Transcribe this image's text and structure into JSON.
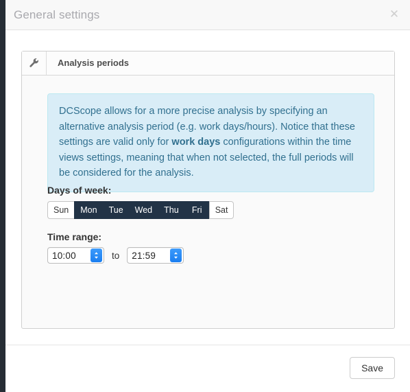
{
  "modal": {
    "title": "General settings",
    "close_icon": "close-icon"
  },
  "panel": {
    "icon": "wrench-icon",
    "title": "Analysis periods"
  },
  "info": {
    "text_part1": "DCScope allows for a more precise analysis by specifying an alternative analysis period (e.g. work days/hours). Notice that these settings are valid only for ",
    "emphasis": "work days",
    "text_part2": " configurations within the time views settings, meaning that when not selected, the full periods will be considered for the analysis."
  },
  "days": {
    "label": "Days of week:",
    "items": [
      {
        "label": "Sun",
        "selected": false
      },
      {
        "label": "Mon",
        "selected": true
      },
      {
        "label": "Tue",
        "selected": true
      },
      {
        "label": "Wed",
        "selected": true
      },
      {
        "label": "Thu",
        "selected": true
      },
      {
        "label": "Fri",
        "selected": true
      },
      {
        "label": "Sat",
        "selected": false
      }
    ]
  },
  "time_range": {
    "label": "Time range:",
    "start_value": "10:00",
    "separator": "to",
    "end_value": "21:59"
  },
  "footer": {
    "save_label": "Save"
  },
  "colors": {
    "selected_day_bg": "#223346",
    "info_bg": "#d9edf7",
    "info_border": "#bce8f1",
    "info_text": "#31708f",
    "stepper_blue": "#1a7ef0",
    "page_edge": "#262d35"
  }
}
